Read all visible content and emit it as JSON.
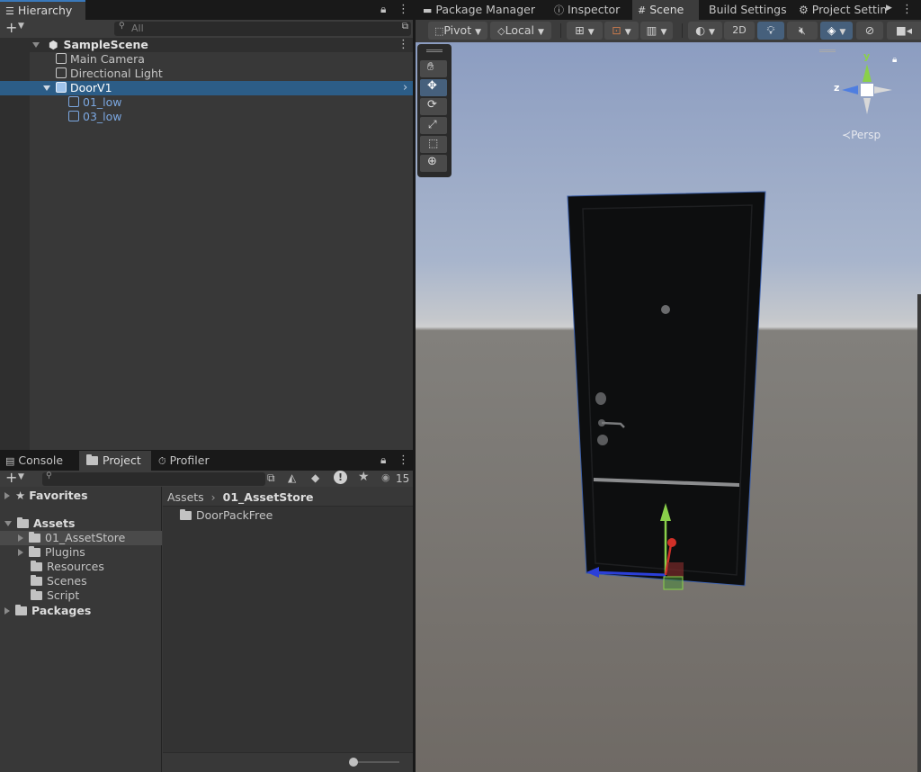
{
  "hierarchy": {
    "tab_label": "Hierarchy",
    "search_placeholder": "All",
    "scene_name": "SampleScene",
    "items": [
      {
        "label": "Main Camera"
      },
      {
        "label": "Directional Light"
      },
      {
        "label": "DoorV1"
      },
      {
        "label": "01_low"
      },
      {
        "label": "03_low"
      }
    ]
  },
  "top_tabs": [
    "Package Manager",
    "Inspector",
    "Scene",
    "Build Settings",
    "Project Settin"
  ],
  "scene_toolbar": {
    "pivot_label": "Pivot",
    "local_label": "Local",
    "mode_2d_label": "2D",
    "persp_label": "Persp",
    "gizmo_y": "y",
    "gizmo_z": "z"
  },
  "bottom_tabs": [
    "Console",
    "Project",
    "Profiler"
  ],
  "project": {
    "hidden_count": "15",
    "favorites_label": "Favorites",
    "assets_label": "Assets",
    "asset_folders": [
      "01_AssetStore",
      "Plugins",
      "Resources",
      "Scenes",
      "Script"
    ],
    "packages_label": "Packages",
    "breadcrumb_root": "Assets",
    "breadcrumb_current": "01_AssetStore",
    "content_items": [
      "DoorPackFree"
    ],
    "zoom_slider_value": 0
  },
  "colors": {
    "selection": "#2c5d87",
    "accent_blue": "#3a79bb",
    "sky_top": "#8fa4c8",
    "ground": "#6f6a65",
    "door": "#0d0e0f",
    "child_link": "#7ba7e0"
  }
}
